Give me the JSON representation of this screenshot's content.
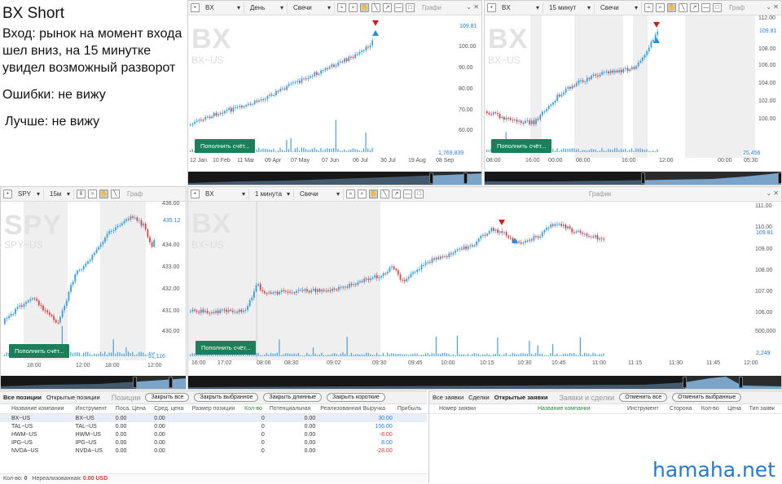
{
  "notes": {
    "title": "BX Short",
    "entry": "Вход: рынок на момент входа шел вниз, на 15 минутке увидел возможный разворот",
    "errors": "Ошибки: не вижу",
    "better": "Лучше: не вижу"
  },
  "colors": {
    "up": "#2a9ad8",
    "down": "#d63a3a",
    "accent": "#1b7f5a",
    "sell_marker": "#c8201e",
    "buy_marker": "#1f8fe0",
    "link": "#2a78c8"
  },
  "charts": {
    "daily": {
      "symbol": "BX",
      "interval": "День",
      "type": "Свечи",
      "graph_label": "Графи",
      "wm_symbol": "BX",
      "wm_sub": "BX~US",
      "y_ticks": [
        "100.00",
        "90.00",
        "80.00",
        "70.00",
        "60.00"
      ],
      "price_tag": "109.81",
      "volume_label": "1,769,839",
      "x_ticks": [
        "12 Jan",
        "10 Feb",
        "11 Mar",
        "09 Apr",
        "07 May",
        "07 Jun",
        "06 Jul",
        "30 Jul",
        "19 Aug",
        "08 Sep"
      ],
      "deposit": "Пополнить счёт..."
    },
    "m15": {
      "symbol": "BX",
      "interval": "15 минут",
      "type": "Свечи",
      "graph_label": "Граф",
      "wm_symbol": "BX",
      "wm_sub": "BX~US",
      "y_ticks": [
        "112.00",
        "110.00",
        "108.00",
        "106.00",
        "104.00",
        "102.00",
        "100.00"
      ],
      "price_tag": "109.81",
      "volume_label": "25,456",
      "x_ticks": [
        "08:00",
        "16:00",
        "00:00",
        "08:00",
        "16:00",
        "12:00",
        "00:00",
        "05:30"
      ],
      "deposit": "Пополнить счёт..."
    },
    "spy": {
      "symbol": "SPY",
      "interval": "15м",
      "graph_label": "Граф",
      "wm_symbol": "SPY",
      "wm_sub": "SPY~US",
      "y_ticks": [
        "436.00",
        "435.00",
        "434.00",
        "433.00",
        "432.00",
        "431.00",
        "430.00"
      ],
      "price_tag": "435.12",
      "volume_label": "91,116",
      "x_ticks": [
        "18:00",
        "12:00",
        "18:00",
        "12:00"
      ],
      "deposit": "Пополнить счёт..."
    },
    "m1": {
      "symbol": "BX",
      "interval": "1 минута",
      "type": "Свечи",
      "graph_label": "График",
      "wm_symbol": "BX",
      "wm_sub": "BX~US",
      "y_ticks": [
        "111.00",
        "110.00",
        "109.00",
        "108.00",
        "107.00",
        "106.00"
      ],
      "price_tag": "109.81",
      "volume_ticks": [
        "500,000",
        "2,249"
      ],
      "x_ticks": [
        "16:00",
        "17:02",
        "08:06",
        "08:30",
        "09:02",
        "09:30",
        "09:45",
        "10:00",
        "10:15",
        "10:30",
        "10:45",
        "11:00",
        "11:15",
        "11:30",
        "11:45",
        "12:00"
      ],
      "deposit": "Пополнить счёт..."
    }
  },
  "positions": {
    "tab_all": "Все позиции",
    "tab_open": "Открытые позиции",
    "title": "Позиции",
    "buttons": [
      "Закрыть все",
      "Закрыть выбранное",
      "Закрыть длинные",
      "Закрыть короткие"
    ],
    "columns": [
      "Название компании",
      "Инструмент",
      "Поса. Цена",
      "Сред. цена",
      "Размер позиции",
      "Кол-во",
      "Потенциальная",
      "Реализованная Выручка",
      "Прибыль"
    ],
    "rows": [
      {
        "name": "BX~US",
        "instr": "BX~US",
        "pos_price": "0.00",
        "avg": "0.00",
        "size": "",
        "qty": "0",
        "potential": "0.00",
        "realized": "30.00"
      },
      {
        "name": "TAL~US",
        "instr": "TAL~US",
        "pos_price": "0.00",
        "avg": "0.00",
        "size": "",
        "qty": "0",
        "potential": "0.00",
        "realized": "156.00"
      },
      {
        "name": "HWM~US",
        "instr": "HWM~US",
        "pos_price": "0.00",
        "avg": "0.00",
        "size": "",
        "qty": "0",
        "potential": "0.00",
        "realized": "-8.00"
      },
      {
        "name": "IPG~US",
        "instr": "IPG~US",
        "pos_price": "0.00",
        "avg": "0.00",
        "size": "",
        "qty": "0",
        "potential": "0.00",
        "realized": "8.00"
      },
      {
        "name": "NVDA~US",
        "instr": "NVDA~US",
        "pos_price": "0.00",
        "avg": "0.00",
        "size": "",
        "qty": "0",
        "potential": "0.00",
        "realized": "-28.00"
      }
    ],
    "footer_qty_label": "Кол-во:",
    "footer_qty": "0",
    "footer_unreal_label": "Нереализованная:",
    "footer_unreal": "0.00 USD"
  },
  "orders": {
    "tab_all": "Все заявки",
    "tab_deals": "Сделки",
    "tab_open": "Открытые заявки",
    "title": "Заявки и сделки",
    "buttons": [
      "Отменить все",
      "Отменить выбранные"
    ],
    "columns": [
      "Номер заявки",
      "Название компании",
      "Инструмент",
      "Сторона",
      "Кол-во",
      "Цена",
      "Тип заявк"
    ]
  },
  "watermark": "hamaha.net"
}
